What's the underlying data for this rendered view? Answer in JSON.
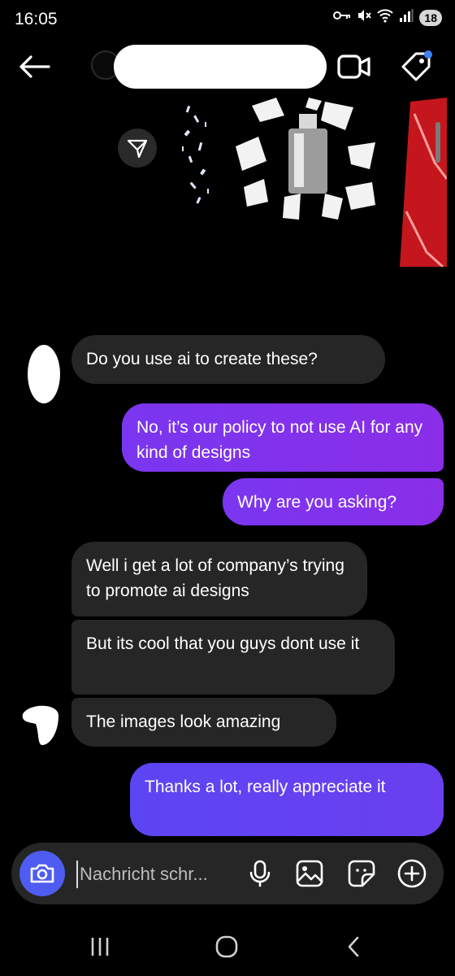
{
  "status_bar": {
    "time": "16:05",
    "battery_level": "18",
    "icons": [
      "key-icon",
      "mute-icon",
      "wifi-icon",
      "signal-icon"
    ]
  },
  "header": {
    "back_icon": "arrow-left-icon",
    "video_call_icon": "video-camera-icon",
    "tag_icon": "tag-icon",
    "notification_color": "#3b82f6"
  },
  "shared_post": {
    "share_icon": "send-icon",
    "accent_red": "#c4161c"
  },
  "messages": [
    {
      "direction": "incoming",
      "text": "Do you use ai to create these?"
    },
    {
      "direction": "outgoing",
      "text": "No, it’s our policy to not use AI for any kind of designs"
    },
    {
      "direction": "outgoing",
      "text": "Why are you asking?"
    },
    {
      "direction": "incoming",
      "text": "Well i get a lot of company’s trying to promote ai designs"
    },
    {
      "direction": "incoming",
      "text": "But its cool that you guys dont use it"
    },
    {
      "direction": "incoming",
      "text": "The images look amazing"
    },
    {
      "direction": "outgoing",
      "text": "Thanks a lot, really appreciate it"
    }
  ],
  "composer": {
    "placeholder": "Nachricht schr...",
    "camera_color": "#4f5cf2",
    "actions": [
      "microphone-icon",
      "gallery-icon",
      "sticker-icon",
      "plus-icon"
    ]
  },
  "nav_bar": [
    "recent-apps-icon",
    "home-icon",
    "back-icon"
  ],
  "colors": {
    "outgoing_purple": "#8a2ee8",
    "outgoing_blue": "#5c45f2",
    "incoming_gray": "#262626"
  }
}
